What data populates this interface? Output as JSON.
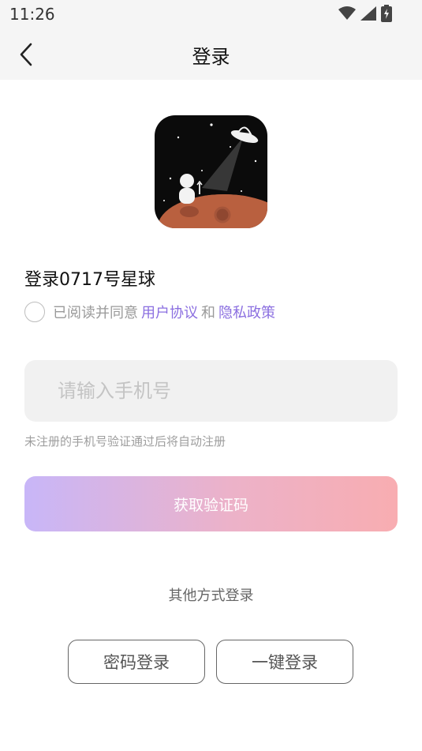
{
  "status_bar": {
    "time": "11:26",
    "icons": [
      "wifi-icon",
      "signal-icon",
      "battery-charging-icon"
    ]
  },
  "header": {
    "back_icon": "chevron-left-icon",
    "title": "登录"
  },
  "logo": {
    "icon": "planet-astronaut-ufo-logo"
  },
  "main": {
    "heading": "登录0717号星球",
    "agreement": {
      "checked": false,
      "prefix": "已阅读并同意",
      "terms_link": "用户协议",
      "connector": "和",
      "privacy_link": "隐私政策"
    },
    "phone_placeholder": "请输入手机号",
    "phone_value": "",
    "hint": "未注册的手机号验证通过后将自动注册",
    "get_code_label": "获取验证码"
  },
  "other_login": {
    "title": "其他方式登录",
    "password_login": "密码登录",
    "one_click_login": "一键登录"
  },
  "colors": {
    "accent_link": "#8b6fe0",
    "button_gradient_start": "#c8b6f8",
    "button_gradient_end": "#f8adb1",
    "header_bg": "#f5f5f5"
  }
}
